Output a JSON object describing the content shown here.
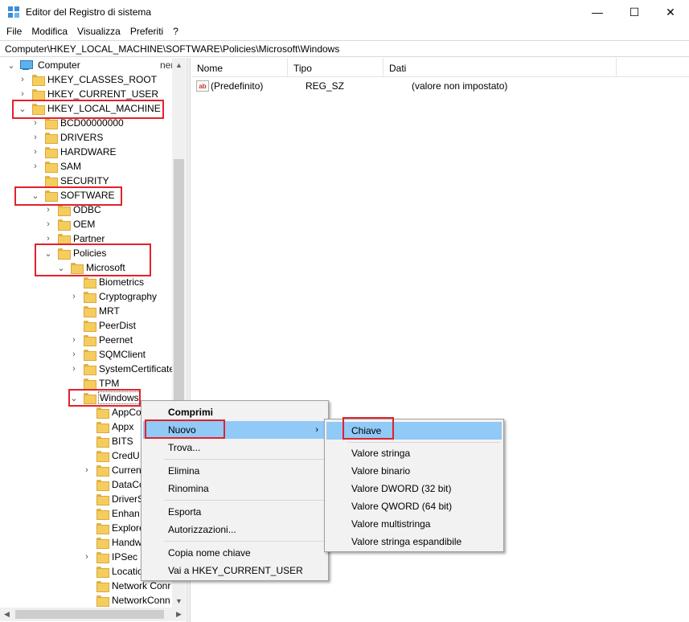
{
  "window": {
    "title": "Editor del Registro di sistema",
    "minimize_glyph": "—",
    "maximize_glyph": "☐",
    "close_glyph": "✕"
  },
  "menu": {
    "items": [
      "File",
      "Modifica",
      "Visualizza",
      "Preferiti",
      "?"
    ]
  },
  "address": "Computer\\HKEY_LOCAL_MACHINE\\SOFTWARE\\Policies\\Microsoft\\Windows",
  "tree": {
    "computer": "Computer",
    "computer_suffix": "ner",
    "nodes": [
      {
        "label": "HKEY_CLASSES_ROOT"
      },
      {
        "label": "HKEY_CURRENT_USER"
      },
      {
        "label": "HKEY_LOCAL_MACHINE"
      },
      {
        "label": "BCD00000000"
      },
      {
        "label": "DRIVERS"
      },
      {
        "label": "HARDWARE"
      },
      {
        "label": "SAM"
      },
      {
        "label": "SECURITY"
      },
      {
        "label": "SOFTWARE"
      },
      {
        "label": "ODBC"
      },
      {
        "label": "OEM"
      },
      {
        "label": "Partner"
      },
      {
        "label": "Policies"
      },
      {
        "label": "Microsoft"
      },
      {
        "label": "Biometrics"
      },
      {
        "label": "Cryptography"
      },
      {
        "label": "MRT"
      },
      {
        "label": "PeerDist"
      },
      {
        "label": "Peernet"
      },
      {
        "label": "SQMClient"
      },
      {
        "label": "SystemCertificate"
      },
      {
        "label": "TPM"
      },
      {
        "label": "Windows"
      },
      {
        "label": "AppCo"
      },
      {
        "label": "Appx"
      },
      {
        "label": "BITS"
      },
      {
        "label": "CredU"
      },
      {
        "label": "Curren"
      },
      {
        "label": "DataCo"
      },
      {
        "label": "DriverS"
      },
      {
        "label": "Enhan"
      },
      {
        "label": "Explore"
      },
      {
        "label": "Handw"
      },
      {
        "label": "IPSec"
      },
      {
        "label": "Locatio"
      },
      {
        "label": "Network Conr"
      },
      {
        "label": "NetworkConn"
      }
    ]
  },
  "list": {
    "columns": [
      "Nome",
      "Tipo",
      "Dati"
    ],
    "rows": [
      {
        "icon": "ab",
        "name": "(Predefinito)",
        "type": "REG_SZ",
        "data": "(valore non impostato)"
      }
    ]
  },
  "context_menu": {
    "items": [
      "Comprimi",
      "Nuovo",
      "Trova...",
      "Elimina",
      "Rinomina",
      "Esporta",
      "Autorizzazioni...",
      "Copia nome chiave",
      "Vai a HKEY_CURRENT_USER"
    ],
    "submenu_arrow": "›"
  },
  "submenu": {
    "items": [
      "Chiave",
      "Valore stringa",
      "Valore binario",
      "Valore DWORD (32 bit)",
      "Valore QWORD (64 bit)",
      "Valore multistringa",
      "Valore stringa espandibile"
    ]
  },
  "colors": {
    "highlight_box": "#e3212b",
    "menu_selection": "#91c9f7",
    "folder": "#f5cd5f"
  }
}
